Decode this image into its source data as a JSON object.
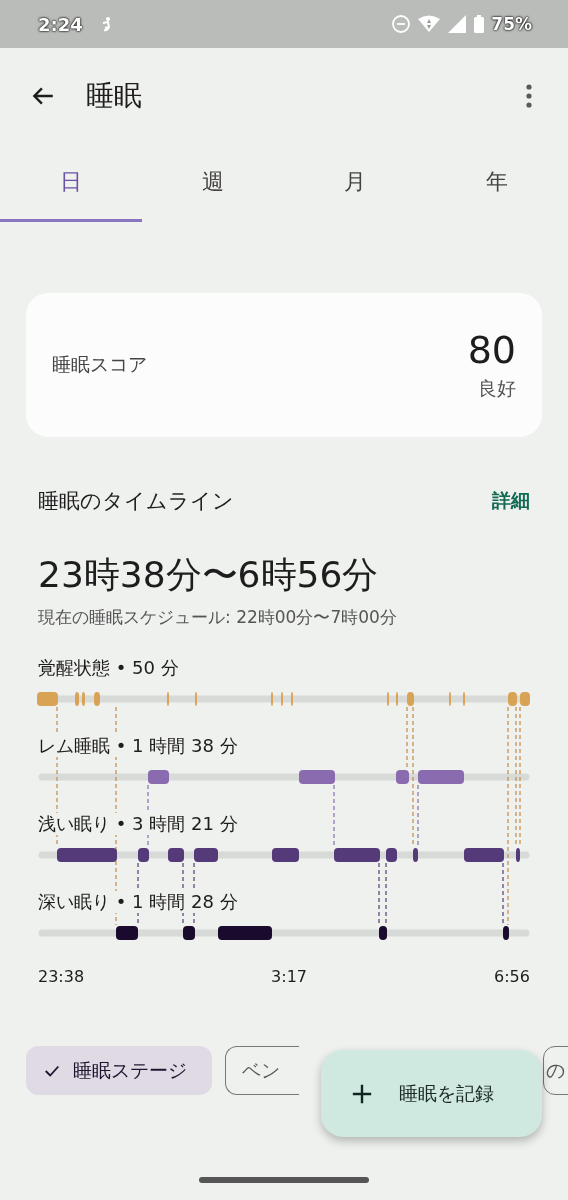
{
  "status_bar": {
    "time": "2:24",
    "battery": "75%"
  },
  "app_bar": {
    "title": "睡眠"
  },
  "tabs": [
    {
      "label": "日",
      "selected": true
    },
    {
      "label": "週",
      "selected": false
    },
    {
      "label": "月",
      "selected": false
    },
    {
      "label": "年",
      "selected": false
    }
  ],
  "score_card": {
    "label": "睡眠スコア",
    "value": "80",
    "rating": "良好"
  },
  "timeline": {
    "title": "睡眠のタイムライン",
    "link": "詳細",
    "range": "23時38分〜6時56分",
    "schedule": "現在の睡眠スケジュール: 22時00分〜7時00分",
    "stages": [
      {
        "kind": "awake",
        "label": "覚醒状態 • 50 分"
      },
      {
        "kind": "rem",
        "label": "レム睡眠 • 1 時間 38 分"
      },
      {
        "kind": "light",
        "label": "浅い眠り • 3 時間 21 分"
      },
      {
        "kind": "deep",
        "label": "深い眠り • 1 時間 28 分"
      }
    ],
    "axis": [
      "23:38",
      "3:17",
      "6:56"
    ]
  },
  "chips": [
    {
      "label": "睡眠ステージ",
      "selected": true
    },
    {
      "label": "ベン",
      "selected": false
    },
    {
      "label": "の",
      "selected": false
    }
  ],
  "fab": {
    "label": "睡眠を記録"
  }
}
